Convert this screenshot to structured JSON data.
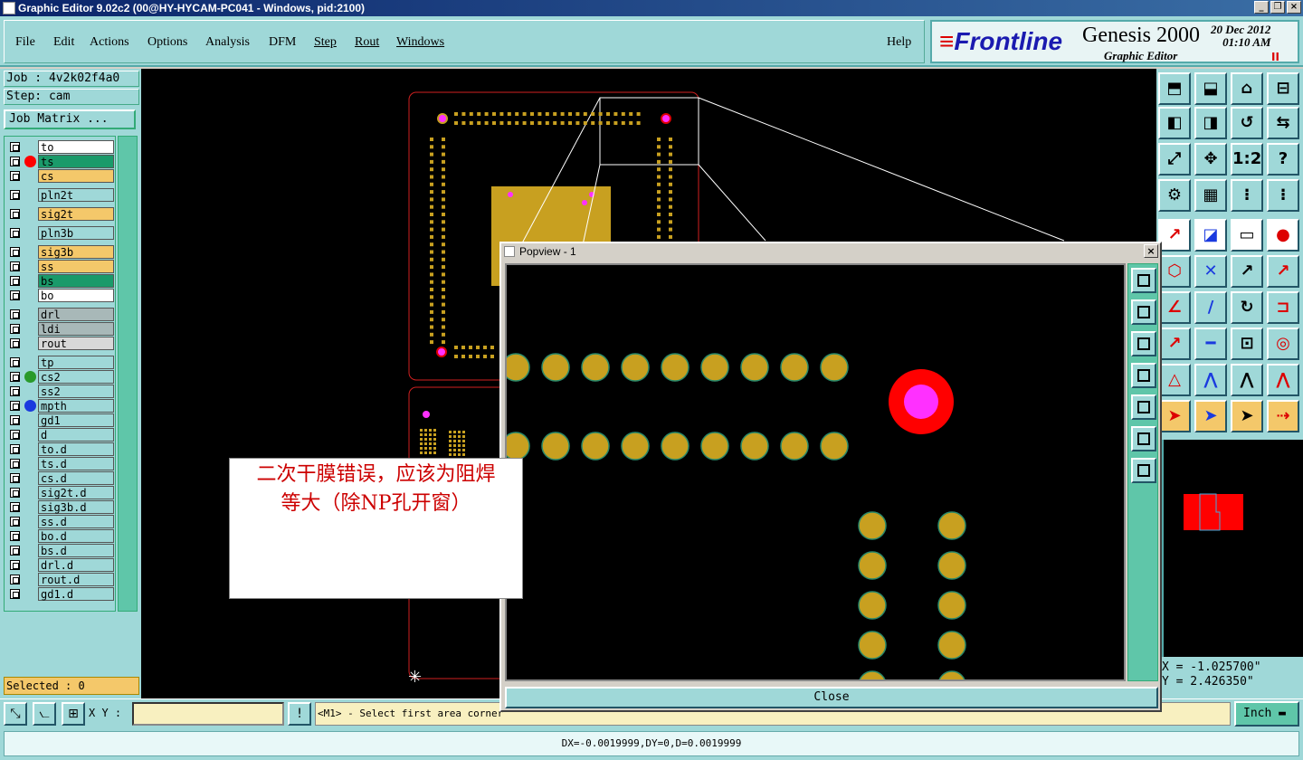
{
  "window": {
    "title": "Graphic Editor 9.02c2 (00@HY-HYCAM-PC041 - Windows, pid:2100)",
    "buttons": [
      "_",
      "❐",
      "×"
    ]
  },
  "menu": [
    {
      "label": "File"
    },
    {
      "label": "Edit"
    },
    {
      "label": "Actions"
    },
    {
      "label": "Options"
    },
    {
      "label": "Analysis"
    },
    {
      "label": "DFM"
    },
    {
      "label": "Step"
    },
    {
      "label": "Rout"
    },
    {
      "label": "Windows"
    },
    {
      "label": "Help"
    }
  ],
  "brand": {
    "logo": "Frontline",
    "product": "Genesis 2000",
    "subtitle": "Graphic Editor",
    "date": "20 Dec 2012",
    "time": "01:10 AM",
    "pause": "II"
  },
  "job": {
    "job_label": "Job : 4v2k02f4a0",
    "step_label": "Step: cam",
    "matrix_button": "Job Matrix ..."
  },
  "layers": [
    {
      "name": "to",
      "color": "#ffffff",
      "dot": ""
    },
    {
      "name": "ts",
      "color": "#1a9a6a",
      "dot": "#ff0000"
    },
    {
      "name": "cs",
      "color": "#f4c86a",
      "dot": ""
    },
    {
      "name": "pln2t",
      "color": "#9fd8d8",
      "dot": ""
    },
    {
      "name": "sig2t",
      "color": "#f4c86a",
      "dot": ""
    },
    {
      "name": "pln3b",
      "color": "#9fd8d8",
      "dot": ""
    },
    {
      "name": "sig3b",
      "color": "#f4c86a",
      "dot": ""
    },
    {
      "name": "ss",
      "color": "#f4c86a",
      "dot": ""
    },
    {
      "name": "bs",
      "color": "#1a9a6a",
      "dot": ""
    },
    {
      "name": "bo",
      "color": "#ffffff",
      "dot": ""
    },
    {
      "name": "drl",
      "color": "#a8b8b8",
      "dot": ""
    },
    {
      "name": "ldi",
      "color": "#a8b8b8",
      "dot": ""
    },
    {
      "name": "rout",
      "color": "#d8d8d8",
      "dot": ""
    },
    {
      "name": "tp",
      "color": "#9fd8d8",
      "dot": ""
    },
    {
      "name": "cs2",
      "color": "#9fd8d8",
      "dot": "#2a9a2a"
    },
    {
      "name": "ss2",
      "color": "#9fd8d8",
      "dot": ""
    },
    {
      "name": "mpth",
      "color": "#9fd8d8",
      "dot": "#1a3adf"
    },
    {
      "name": "gd1",
      "color": "#9fd8d8",
      "dot": ""
    },
    {
      "name": "d",
      "color": "#9fd8d8",
      "dot": ""
    },
    {
      "name": "to.d",
      "color": "#9fd8d8",
      "dot": ""
    },
    {
      "name": "ts.d",
      "color": "#9fd8d8",
      "dot": ""
    },
    {
      "name": "cs.d",
      "color": "#9fd8d8",
      "dot": ""
    },
    {
      "name": "sig2t.d",
      "color": "#9fd8d8",
      "dot": ""
    },
    {
      "name": "sig3b.d",
      "color": "#9fd8d8",
      "dot": ""
    },
    {
      "name": "ss.d",
      "color": "#9fd8d8",
      "dot": ""
    },
    {
      "name": "bo.d",
      "color": "#9fd8d8",
      "dot": ""
    },
    {
      "name": "bs.d",
      "color": "#9fd8d8",
      "dot": ""
    },
    {
      "name": "drl.d",
      "color": "#9fd8d8",
      "dot": ""
    },
    {
      "name": "rout.d",
      "color": "#9fd8d8",
      "dot": ""
    },
    {
      "name": "gd1.d",
      "color": "#9fd8d8",
      "dot": ""
    }
  ],
  "selected": "Selected : 0",
  "popview": {
    "title": "Popview - 1",
    "close_label": "Close"
  },
  "annotation": {
    "line1": "二次干膜错误，应该为阻焊",
    "line2": "等大（除NP孔开窗）"
  },
  "coords": {
    "x": "X = -1.025700\"",
    "y": "Y = 2.426350\""
  },
  "bottom": {
    "xy_label": "X Y :",
    "xy_value": "",
    "prompt": "<M1> - Select first area corner",
    "units": "Inch"
  },
  "status": "DX=-0.0019999,DY=0,D=0.0019999",
  "colors": {
    "panel": "#9fd8d8",
    "pad": "#c8a020",
    "accent": "#f4c86a",
    "red": "#ff0000",
    "magenta": "#ff30ff"
  }
}
